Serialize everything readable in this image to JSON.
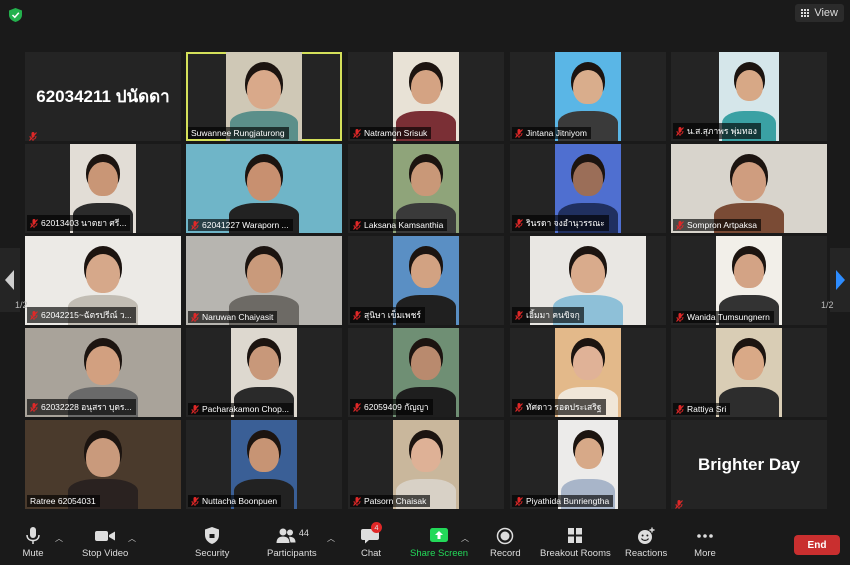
{
  "topbar": {
    "view_label": "View"
  },
  "pager": {
    "left_indicator": "1/2",
    "right_indicator": "1/2"
  },
  "tiles": [
    {
      "name": "62034211 ปนัดดา",
      "kind": "text",
      "muted": true
    },
    {
      "name": "Suwannee Rungjaturong",
      "kind": "video",
      "active": true,
      "muted": false,
      "bg": "#cfc8b6",
      "skin": "#d9a98a",
      "shirt": "#5b8f8a"
    },
    {
      "name": "Natramon Srisuk",
      "kind": "video",
      "muted": true,
      "bg": "#e8e2d6",
      "skin": "#d4a383",
      "shirt": "#7a2f35"
    },
    {
      "name": "Jintana Jitniyom",
      "kind": "video",
      "muted": true,
      "bg": "#5ab6e6",
      "skin": "#d9ad8c",
      "shirt": "#3a3a3a"
    },
    {
      "name": "น.ส.สุภาพร พุ่มทอง",
      "kind": "video",
      "muted": true,
      "bg": "#d5e6ea",
      "skin": "#d7a886",
      "shirt": "#3aa1a4"
    },
    {
      "name": "62013403 นาตยา ศรี...",
      "kind": "video",
      "muted": true,
      "bg": "#e2ddd6",
      "skin": "#c99676",
      "shirt": "#2b2b2b"
    },
    {
      "name": "62041227 Waraporn ...",
      "kind": "video",
      "muted": true,
      "bg": "#6fb5c8",
      "skin": "#c89070",
      "shirt": "#222222"
    },
    {
      "name": "Laksana Kamsanthia",
      "kind": "video",
      "muted": true,
      "bg": "#8fa47a",
      "skin": "#c99878",
      "shirt": "#3a3a3a"
    },
    {
      "name": "รินรดา จงอำนุวรรณะ",
      "kind": "video",
      "muted": true,
      "bg": "#4f6fd0",
      "skin": "#9b6e58",
      "shirt": "#203060"
    },
    {
      "name": "Sompron Artpaksa",
      "kind": "video",
      "muted": true,
      "bg": "#d8d4cc",
      "skin": "#cf9d7f",
      "shirt": "#7a4b35"
    },
    {
      "name": "62042215~ฉัตรปรีณ์ ว...",
      "kind": "video",
      "muted": true,
      "bg": "#eceae6",
      "skin": "#d6a88a",
      "shirt": "#c2bdb4"
    },
    {
      "name": "Naruwan Chaiyasit",
      "kind": "video",
      "muted": true,
      "bg": "#b7b5b0",
      "skin": "#c99a7b",
      "shirt": "#6d6a65"
    },
    {
      "name": "สุนิษา เข็มเพชร์",
      "kind": "video",
      "muted": true,
      "bg": "#5a8fc4",
      "skin": "#d2a282",
      "shirt": "#202020"
    },
    {
      "name": "เอิ้มมา คนขิจกุ",
      "kind": "video",
      "muted": true,
      "bg": "#e9e7e3",
      "skin": "#d9ab8c",
      "shirt": "#8ec0d8"
    },
    {
      "name": "Wanida Tumsungnern",
      "kind": "video",
      "muted": true,
      "bg": "#f2efe9",
      "skin": "#d3a385",
      "shirt": "#333333"
    },
    {
      "name": "62032228 อนุสรา บุตร...",
      "kind": "video",
      "muted": true,
      "bg": "#a9a39a",
      "skin": "#d2a080",
      "shirt": "#6a6a6a"
    },
    {
      "name": "Pacharakamon Chop...",
      "kind": "video",
      "muted": true,
      "bg": "#ddd8cf",
      "skin": "#c8987a",
      "shirt": "#2a2a2a"
    },
    {
      "name": "62059409 กัญญา",
      "kind": "video",
      "muted": true,
      "bg": "#6f8f74",
      "skin": "#b98a6e",
      "shirt": "#1e1e1e"
    },
    {
      "name": "ทัศดาว รอดประเสริฐ",
      "kind": "video",
      "muted": true,
      "bg": "#e3b98a",
      "skin": "#e0b297",
      "shirt": "#f0e6d8"
    },
    {
      "name": "Rattiya Sri",
      "kind": "video",
      "muted": true,
      "bg": "#d9cdb5",
      "skin": "#d9a987",
      "shirt": "#2d2d2d"
    },
    {
      "name": "Ratree 62054031",
      "kind": "video",
      "muted": false,
      "bg": "#4a3a2c",
      "skin": "#c99a7c",
      "shirt": "#2a2220"
    },
    {
      "name": "Nuttacha Boonpuen",
      "kind": "video",
      "muted": true,
      "bg": "#3a5f96",
      "skin": "#c79474",
      "shirt": "#222222"
    },
    {
      "name": "Patsorn Chaisak",
      "kind": "video",
      "muted": true,
      "bg": "#c9b79c",
      "skin": "#deb196",
      "shirt": "#d8d1c6"
    },
    {
      "name": "Piyathida Bunriengtha",
      "kind": "video",
      "muted": true,
      "bg": "#ecebea",
      "skin": "#d7a988",
      "shirt": "#a8b5c9"
    },
    {
      "name": "Brighter Day",
      "kind": "text",
      "muted": true
    }
  ],
  "toolbar": {
    "mute_label": "Mute",
    "video_label": "Stop Video",
    "security_label": "Security",
    "participants_label": "Participants",
    "participants_count": "44",
    "chat_label": "Chat",
    "chat_badge": "4",
    "share_label": "Share Screen",
    "record_label": "Record",
    "breakout_label": "Breakout Rooms",
    "reactions_label": "Reactions",
    "more_label": "More",
    "end_label": "End"
  },
  "colors": {
    "share_green": "#23d959",
    "end_red": "#c92f2f",
    "active_speaker": "#d4e05a",
    "mute_red": "#e02828"
  }
}
